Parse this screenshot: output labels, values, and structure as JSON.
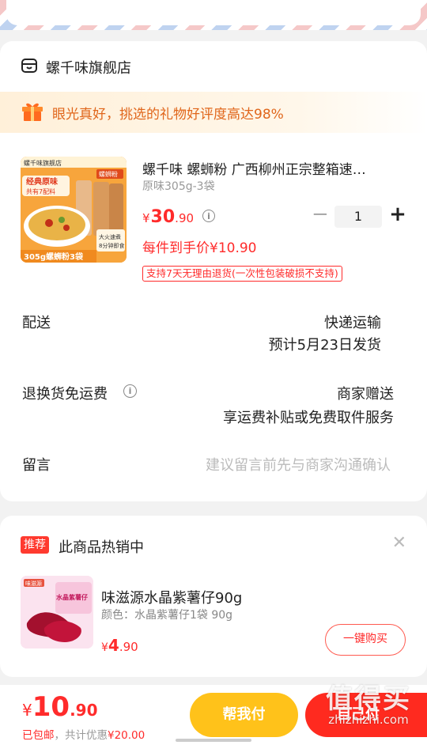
{
  "shop": {
    "name": "螺千味旗舰店",
    "gift_banner": "眼光真好，挑选的礼物好评度高达98%"
  },
  "product": {
    "title": "螺千味 螺蛳粉 广西柳州正宗整箱速…",
    "spec": "原味305g-3袋",
    "price_symbol": "¥",
    "price_int": "30",
    "price_dec": ".90",
    "quantity": "1",
    "unit_price": "每件到手价¥10.90",
    "return_policy": "支持7天无理由退货(一次性包装破损不支持)",
    "image_texts": {
      "brand": "螺千味旗舰店",
      "top_tag": "螺蛳粉",
      "badge1": "经典原味",
      "badge2": "共有7配料",
      "weight": "305g螺蛳粉3袋",
      "side1": "大火速煮",
      "side2": "8分钟即食"
    }
  },
  "delivery": {
    "label": "配送",
    "method": "快递运输",
    "eta": "预计5月23日发货"
  },
  "return_shipping": {
    "label": "退换货免运费",
    "value1": "商家赠送",
    "value2": "享运费补贴或免费取件服务"
  },
  "message": {
    "label": "留言",
    "placeholder": "建议留言前先与商家沟通确认"
  },
  "recommend": {
    "badge": "推荐",
    "title": "此商品热销中",
    "item_name": "味滋源水晶紫薯仔90g",
    "item_spec": "颜色：水晶紫薯仔1袋 90g",
    "price_symbol": "¥",
    "price_int": "4",
    "price_dec": ".90",
    "buy_label": "一键购买",
    "image_texts": {
      "brand": "味滋源",
      "name": "水晶紫薯仔"
    }
  },
  "footer": {
    "total_symbol": "¥",
    "total_int": "10",
    "total_dec": ".90",
    "shipping_free": "已包邮",
    "discount_label": "，共计优惠",
    "discount_value": "¥20.00",
    "help_pay": "帮我付",
    "self_pay": "自己付"
  },
  "watermark": {
    "logo": "值得买",
    "url": "zhizhizhi.com"
  },
  "colors": {
    "accent": "#ff2b2b",
    "gift_orange": "#e0661b",
    "help_yellow": "#ffc21a"
  }
}
